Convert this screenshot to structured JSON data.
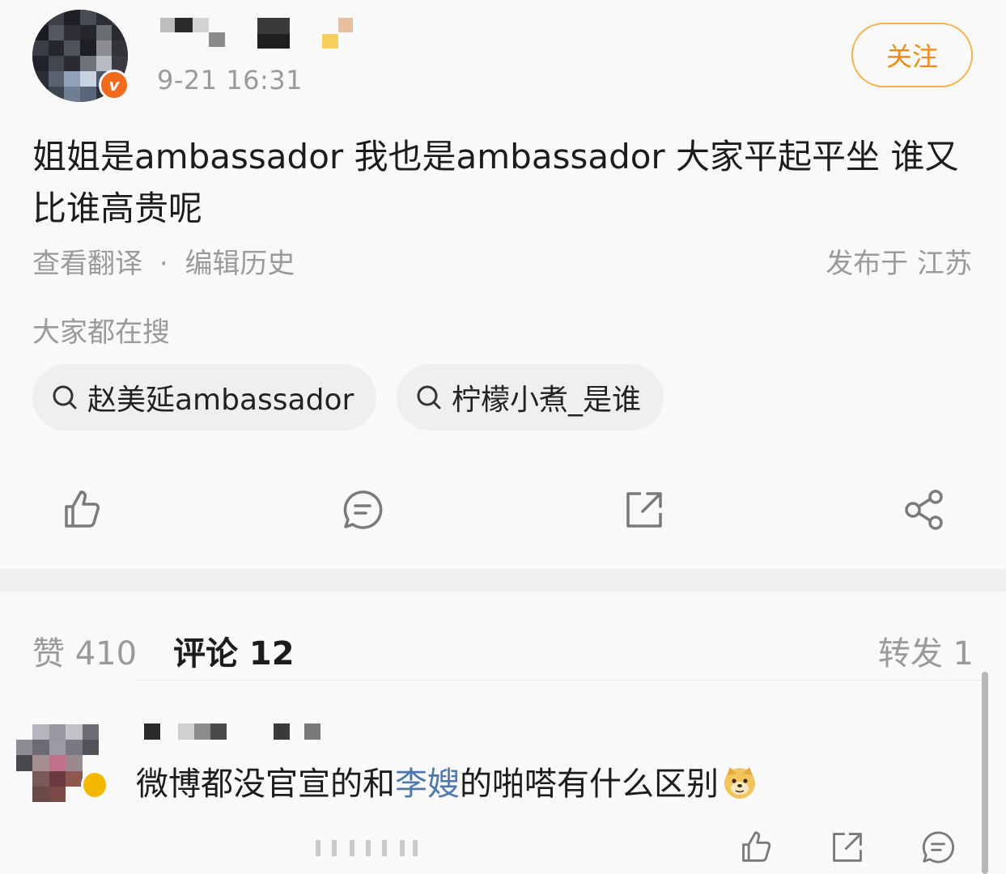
{
  "post": {
    "time": "9-21 16:31",
    "follow_label": "关注",
    "text": "姐姐是ambassador 我也是ambassador 大家平起平坐 谁又比谁高贵呢",
    "translate_link": "查看翻译",
    "separator": "·",
    "edit_history_link": "编辑历史",
    "location": "发布于 江苏"
  },
  "hot_search": {
    "label": "大家都在搜",
    "chips": [
      {
        "text": "赵美延ambassador"
      },
      {
        "text": "柠檬小煮_是谁"
      }
    ]
  },
  "actions": {
    "icons": [
      "like-icon",
      "comment-icon",
      "repost-icon",
      "share-icon"
    ]
  },
  "tabs": {
    "likes": "赞 410",
    "comments": "评论 12",
    "reposts": "转发 1"
  },
  "comment": {
    "text_before": "微博都没官宣的和",
    "mention": "李嫂",
    "text_after": "的啪嗒有什么区别",
    "emoji": "doge-emoji"
  },
  "colors": {
    "background": "#f9f9f9",
    "follow_orange": "#f08c11",
    "verify_badge": "#f26a1b",
    "mention_blue": "#4d78b0",
    "muted_gray": "#9a9a9a"
  }
}
